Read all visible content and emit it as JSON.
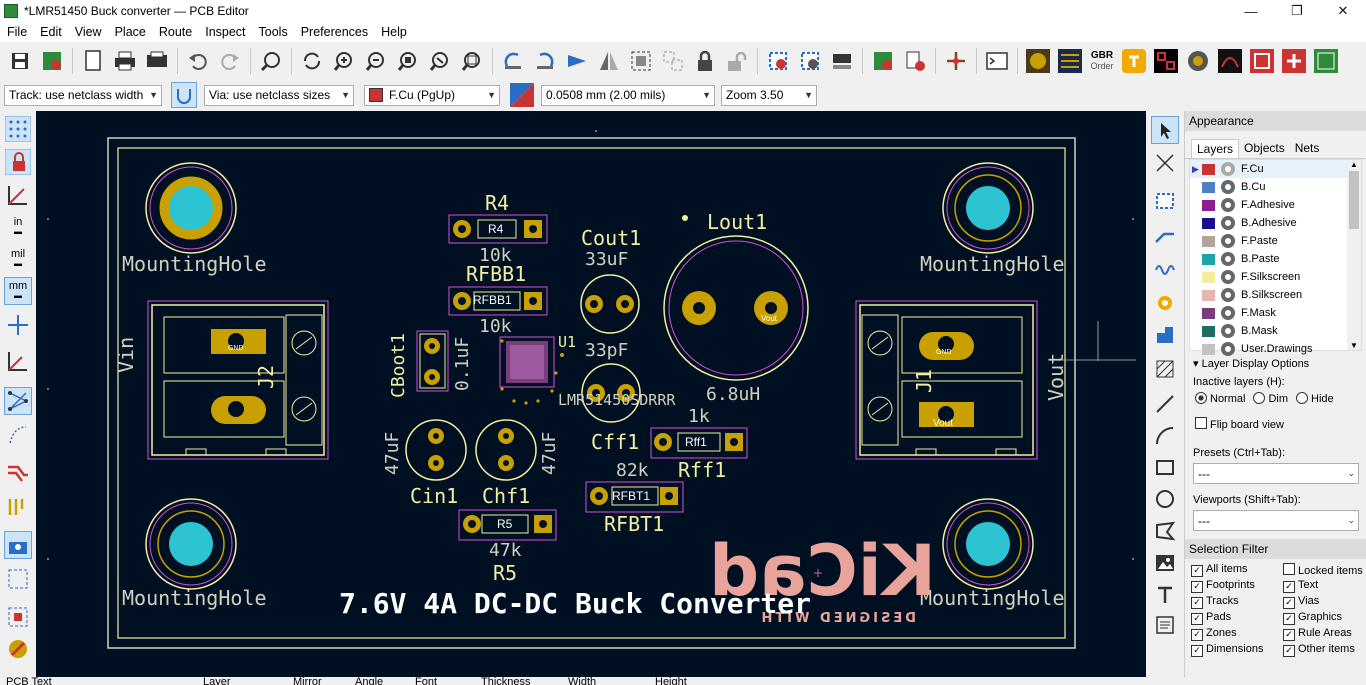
{
  "window": {
    "title": "*LMR51450 Buck converter — PCB Editor",
    "minimize": "—",
    "maximize": "❐",
    "close": "✕"
  },
  "menu": [
    "File",
    "Edit",
    "View",
    "Place",
    "Route",
    "Inspect",
    "Tools",
    "Preferences",
    "Help"
  ],
  "options": {
    "track": "Track: use netclass width",
    "via": "Via: use netclass sizes",
    "layer": "F.Cu (PgUp)",
    "layer_color": "#c83434",
    "grid": "0.0508 mm (2.00 mils)",
    "zoom": "Zoom 3.50"
  },
  "left_toolbar": {
    "units_in": "in",
    "units_mil": "mil",
    "units_mm": "mm"
  },
  "toolbar": {
    "gbr_top": "GBR",
    "gbr_bottom": "Order"
  },
  "pcb": {
    "colors": {
      "background": "#001023",
      "silk": "#f2eda1",
      "pad": "#c8a000",
      "hole": "#2bc4d0",
      "courtyard": "#d44fd4",
      "edge": "#d0d0c0",
      "logo": "#e8a39a"
    },
    "title": "7.6V 4A DC-DC Buck Converter",
    "logo_text": "KiCad",
    "logo_sub": "DESIGNED WITH",
    "labels": {
      "mh": "MountingHole",
      "vin": "Vin",
      "vout": "Vout",
      "j1": "J1",
      "j2": "J2",
      "gnd": "GND",
      "r4": "R4",
      "r4_val": "10k",
      "rfbb1": "RFBB1",
      "rfbb1_val": "10k",
      "cout1": "Cout1",
      "cout1_val": "33uF",
      "lout1": "Lout1",
      "lout1_val": "6.8uH",
      "u1": "U1",
      "u1_val": "LMR51450SDRRR",
      "cboot1": "CBoot1",
      "cboot1_val": "0.1uF",
      "cff1": "Cff1",
      "cff1_val": "33pF",
      "rff1": "Rff1",
      "rff1_val": "1k",
      "rfbt1": "RFBT1",
      "rfbt1_val": "82k",
      "cin1": "Cin1",
      "cin1_val": "47uF",
      "chf1": "Chf1",
      "chf1_val": "47uF",
      "r5": "R5",
      "r5_val": "47k"
    }
  },
  "appearance": {
    "title": "Appearance",
    "tabs": [
      "Layers",
      "Objects",
      "Nets"
    ],
    "layers": [
      {
        "name": "F.Cu",
        "color": "#c83434"
      },
      {
        "name": "B.Cu",
        "color": "#4d7fc4"
      },
      {
        "name": "F.Adhesive",
        "color": "#8e1e8e"
      },
      {
        "name": "B.Adhesive",
        "color": "#1a0f8c"
      },
      {
        "name": "F.Paste",
        "color": "#b5a29a"
      },
      {
        "name": "B.Paste",
        "color": "#1aa6a6"
      },
      {
        "name": "F.Silkscreen",
        "color": "#f2eda1"
      },
      {
        "name": "B.Silkscreen",
        "color": "#e8b4ae"
      },
      {
        "name": "F.Mask",
        "color": "#7a3c7a"
      },
      {
        "name": "B.Mask",
        "color": "#1c6e62"
      },
      {
        "name": "User.Drawings",
        "color": "#c2c2c2"
      }
    ],
    "display_options": "Layer Display Options",
    "inactive_label": "Inactive layers (H):",
    "inactive_opts": [
      "Normal",
      "Dim",
      "Hide"
    ],
    "flip": "Flip board view",
    "presets_label": "Presets (Ctrl+Tab):",
    "presets_value": "---",
    "viewports_label": "Viewports (Shift+Tab):",
    "viewports_value": "---"
  },
  "selection_filter": {
    "title": "Selection Filter",
    "items": [
      {
        "label": "All items",
        "checked": true
      },
      {
        "label": "Locked items",
        "checked": false
      },
      {
        "label": "Footprints",
        "checked": true
      },
      {
        "label": "Text",
        "checked": true
      },
      {
        "label": "Tracks",
        "checked": true
      },
      {
        "label": "Vias",
        "checked": true
      },
      {
        "label": "Pads",
        "checked": true
      },
      {
        "label": "Graphics",
        "checked": true
      },
      {
        "label": "Zones",
        "checked": true
      },
      {
        "label": "Rule Areas",
        "checked": true
      },
      {
        "label": "Dimensions",
        "checked": true
      },
      {
        "label": "Other items",
        "checked": true
      }
    ]
  },
  "status": [
    "PCB Text",
    "Layer",
    "Mirror",
    "Angle",
    "Font",
    "Thickness",
    "Width",
    "Height"
  ]
}
